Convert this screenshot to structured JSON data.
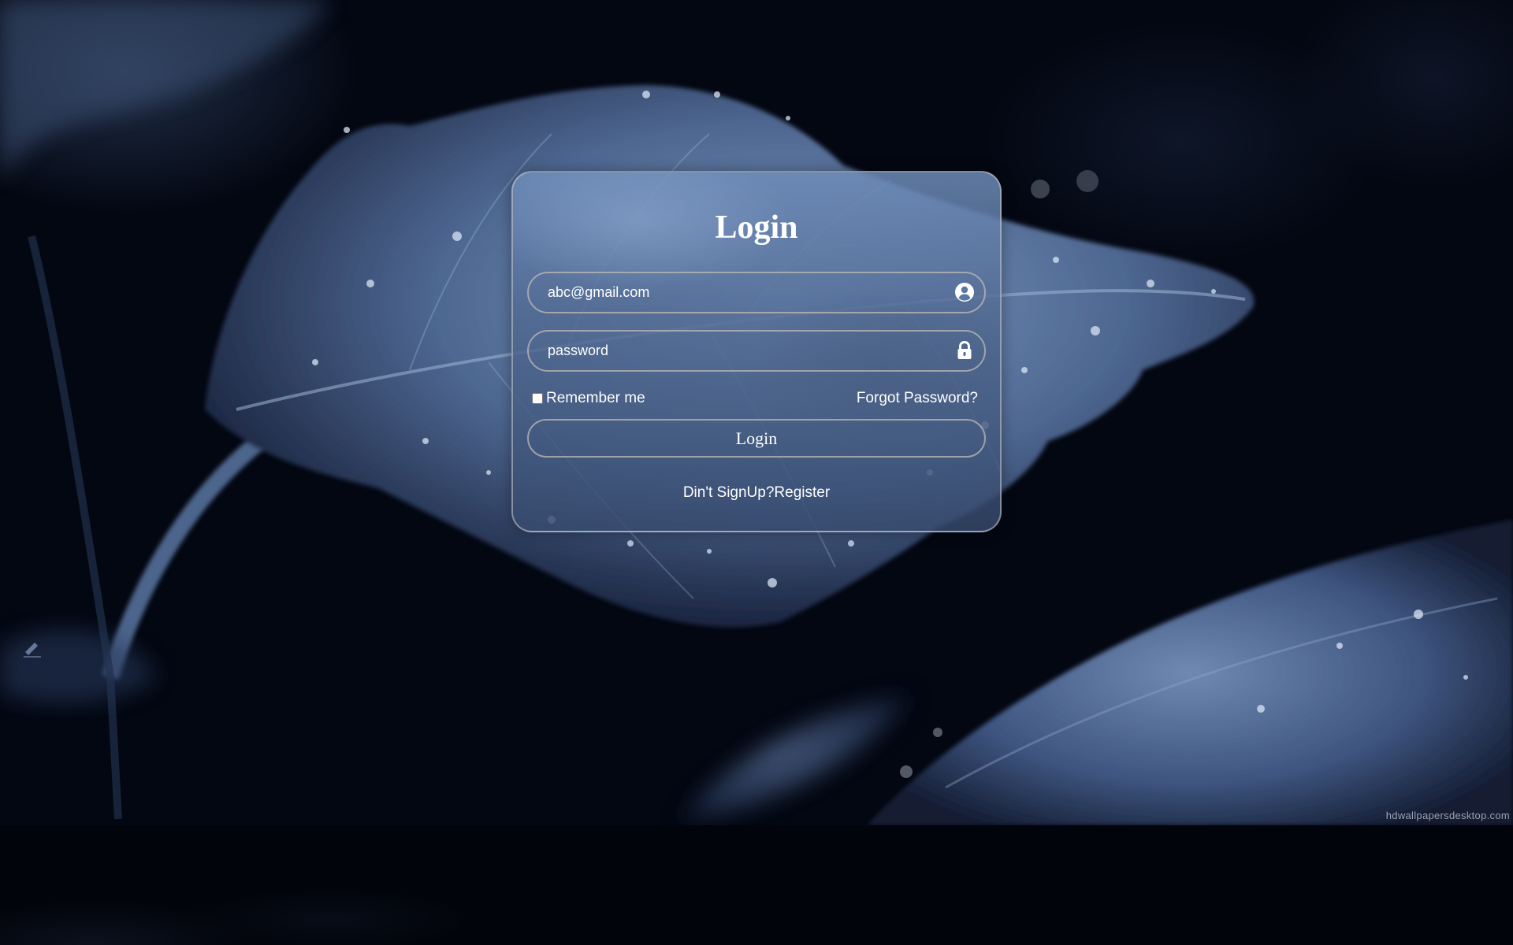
{
  "colors": {
    "background": "#02040b",
    "card_tint": "#5a78a6",
    "border": "#bdb8b2",
    "text": "#ffffff",
    "watermark": "#9aa3b3"
  },
  "login_card": {
    "title": "Login",
    "email_field": {
      "value": "abc@gmail.com",
      "icon": "user-circle-icon"
    },
    "password_field": {
      "placeholder": "password",
      "icon": "lock-icon"
    },
    "remember_me": {
      "label": "Remember me",
      "checked": false
    },
    "forgot_password_label": "Forgot Password?",
    "login_button_label": "Login",
    "register": {
      "prompt": "Din't SignUp?",
      "link_label": "Register"
    }
  },
  "wallpaper": {
    "watermark": "hdwallpapersdesktop.com"
  }
}
